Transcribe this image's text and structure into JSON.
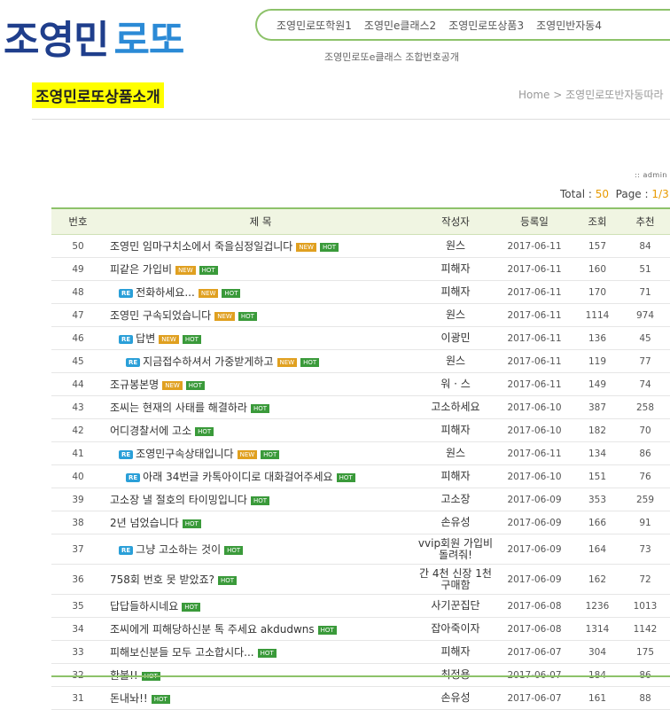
{
  "logo": {
    "main": "조영민",
    "sub": "로또"
  },
  "gnb": [
    "조영민로또학원1",
    "조영민e클래스2",
    "조영민로또상품3",
    "조영민반자동4"
  ],
  "subnav": "조영민로또e클래스 조합번호공개",
  "page_title": "조영민로또상품소개",
  "breadcrumb": "Home > 조영민로또반자동따라",
  "admin_label": "admin",
  "totals": {
    "total_label": "Total :",
    "total": "50",
    "page_label": "Page :",
    "page": "1/3"
  },
  "columns": [
    "번호",
    "제 목",
    "작성자",
    "등록일",
    "조회",
    "추천"
  ],
  "rows": [
    {
      "no": "50",
      "depth": 0,
      "subject": "조영민 임마구치소에서 죽을심정일겁니다",
      "new": true,
      "hot": true,
      "writer": "원스",
      "date": "2017-06-11",
      "views": "157",
      "rec": "84"
    },
    {
      "no": "49",
      "depth": 0,
      "subject": "피같은 가입비",
      "new": true,
      "hot": true,
      "writer": "피해자",
      "date": "2017-06-11",
      "views": "160",
      "rec": "51"
    },
    {
      "no": "48",
      "depth": 1,
      "subject": "전화하세요...",
      "new": true,
      "hot": true,
      "writer": "피해자",
      "date": "2017-06-11",
      "views": "170",
      "rec": "71"
    },
    {
      "no": "47",
      "depth": 0,
      "subject": "조영민 구속되었습니다",
      "new": true,
      "hot": true,
      "writer": "원스",
      "date": "2017-06-11",
      "views": "1114",
      "rec": "974"
    },
    {
      "no": "46",
      "depth": 1,
      "subject": "답변",
      "new": true,
      "hot": true,
      "writer": "이광민",
      "date": "2017-06-11",
      "views": "136",
      "rec": "45"
    },
    {
      "no": "45",
      "depth": 2,
      "subject": "지금접수하셔서 가중받게하고",
      "new": true,
      "hot": true,
      "writer": "원스",
      "date": "2017-06-11",
      "views": "119",
      "rec": "77"
    },
    {
      "no": "44",
      "depth": 0,
      "subject": "조규봉본명",
      "new": true,
      "hot": true,
      "writer": "워 · 스",
      "date": "2017-06-11",
      "views": "149",
      "rec": "74"
    },
    {
      "no": "43",
      "depth": 0,
      "subject": "조씨는 현재의 사태를 해결하라",
      "new": false,
      "hot": true,
      "writer": "고소하세요",
      "date": "2017-06-10",
      "views": "387",
      "rec": "258"
    },
    {
      "no": "42",
      "depth": 0,
      "subject": "어디경찰서에 고소",
      "new": false,
      "hot": true,
      "writer": "피해자",
      "date": "2017-06-10",
      "views": "182",
      "rec": "70"
    },
    {
      "no": "41",
      "depth": 1,
      "subject": "조영민구속상태입니다",
      "new": true,
      "hot": true,
      "writer": "원스",
      "date": "2017-06-11",
      "views": "134",
      "rec": "86"
    },
    {
      "no": "40",
      "depth": 2,
      "subject": "아래 34번글 카톡아이디로 대화걸어주세요",
      "new": false,
      "hot": true,
      "writer": "피해자",
      "date": "2017-06-10",
      "views": "151",
      "rec": "76"
    },
    {
      "no": "39",
      "depth": 0,
      "subject": "고소장 낼 절호의 타이밍입니다",
      "new": false,
      "hot": true,
      "writer": "고소장",
      "date": "2017-06-09",
      "views": "353",
      "rec": "259"
    },
    {
      "no": "38",
      "depth": 0,
      "subject": "2년 넘었습니다",
      "new": false,
      "hot": true,
      "writer": "손유성",
      "date": "2017-06-09",
      "views": "166",
      "rec": "91"
    },
    {
      "no": "37",
      "depth": 1,
      "subject": "그냥 고소하는 것이",
      "new": false,
      "hot": true,
      "writer": "vvip회원 가입비 돌려줘!",
      "date": "2017-06-09",
      "views": "164",
      "rec": "73",
      "tall": true
    },
    {
      "no": "36",
      "depth": 0,
      "subject": "758회 번호 못 받았죠?",
      "new": false,
      "hot": true,
      "writer": "간 4천 신장 1천 구매함",
      "date": "2017-06-09",
      "views": "162",
      "rec": "72",
      "tall": true
    },
    {
      "no": "35",
      "depth": 0,
      "subject": "답답들하시네요",
      "new": false,
      "hot": true,
      "writer": "사기꾼집단",
      "date": "2017-06-08",
      "views": "1236",
      "rec": "1013"
    },
    {
      "no": "34",
      "depth": 0,
      "subject": "조씨에게 피해당하신분 톡 주세요 akdudwns",
      "new": false,
      "hot": true,
      "writer": "잡아죽이자",
      "date": "2017-06-08",
      "views": "1314",
      "rec": "1142"
    },
    {
      "no": "33",
      "depth": 0,
      "subject": "피해보신분들 모두 고소합시다...",
      "new": false,
      "hot": true,
      "writer": "피해자",
      "date": "2017-06-07",
      "views": "304",
      "rec": "175"
    },
    {
      "no": "32",
      "depth": 0,
      "subject": "환불!!",
      "new": false,
      "hot": true,
      "writer": "최정용",
      "date": "2017-06-07",
      "views": "184",
      "rec": "86"
    },
    {
      "no": "31",
      "depth": 0,
      "subject": "돈내놔!!",
      "new": false,
      "hot": true,
      "writer": "손유성",
      "date": "2017-06-07",
      "views": "161",
      "rec": "88"
    }
  ],
  "badges": {
    "re": "RE",
    "new": "NEW",
    "hot": "HOT"
  },
  "colors": {
    "accent_green": "#8dc26a",
    "logo_dark": "#1f3e8c",
    "logo_light": "#2b8ad6",
    "title_highlight": "#ffff00",
    "hot": "#3a9a3a",
    "new": "#e0a020",
    "re": "#2a9fd8"
  }
}
